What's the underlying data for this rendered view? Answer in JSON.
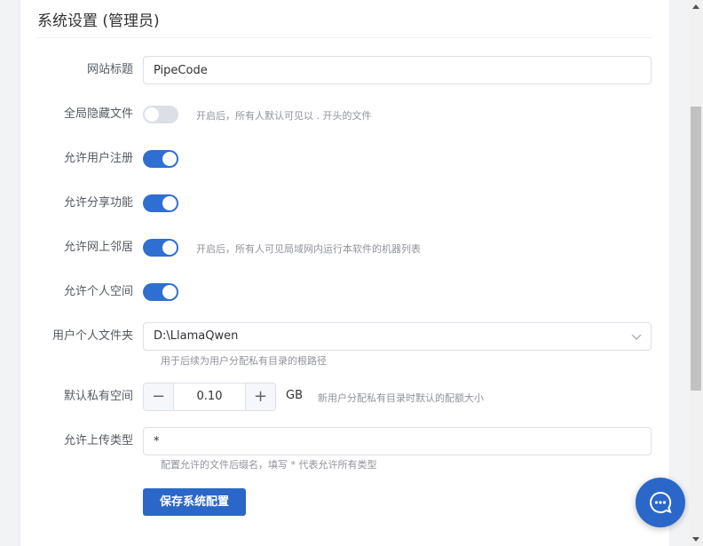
{
  "panel": {
    "title": "系统设置 (管理员)"
  },
  "form": {
    "site_title": {
      "label": "网站标题",
      "value": "PipeCode"
    },
    "global_hide": {
      "label": "全局隐藏文件",
      "on": false,
      "hint": "开启后，所有人默认可见以 . 开头的文件"
    },
    "allow_register": {
      "label": "允许用户注册",
      "on": true
    },
    "allow_share": {
      "label": "允许分享功能",
      "on": true
    },
    "allow_neighbor": {
      "label": "允许网上邻居",
      "on": true,
      "hint": "开启后，所有人可见局域网内运行本软件的机器列表"
    },
    "allow_personal": {
      "label": "允许个人空间",
      "on": true
    },
    "user_folder": {
      "label": "用户个人文件夹",
      "value": "D:\\LlamaQwen",
      "hint": "用于后续为用户分配私有目录的根路径"
    },
    "private_space": {
      "label": "默认私有空间",
      "value": "0.10",
      "unit": "GB",
      "minus": "−",
      "plus": "+",
      "hint": "新用户分配私有目录时默认的配额大小"
    },
    "upload_types": {
      "label": "允许上传类型",
      "value": "*",
      "hint": "配置允许的文件后缀名，填写 * 代表允许所有类型"
    },
    "save_label": "保存系统配置"
  },
  "colors": {
    "primary": "#2a67c8",
    "switch_on": "#2e6fd1",
    "switch_off": "#dcdfe6"
  }
}
